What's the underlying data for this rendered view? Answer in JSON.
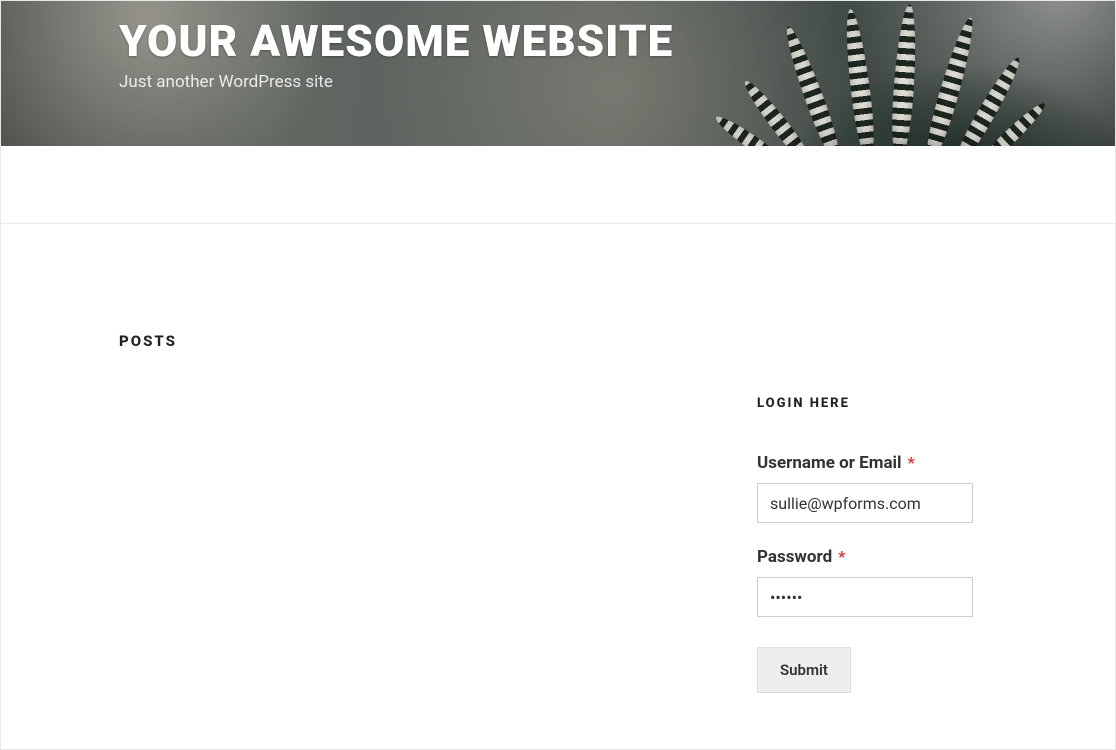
{
  "header": {
    "site_title": "YOUR AWESOME WEBSITE",
    "tagline": "Just another WordPress site"
  },
  "main": {
    "posts_heading": "POSTS"
  },
  "sidebar": {
    "widget_title": "LOGIN HERE",
    "form": {
      "username": {
        "label": "Username or Email",
        "required_marker": "*",
        "value": "sullie@wpforms.com"
      },
      "password": {
        "label": "Password",
        "required_marker": "*",
        "value": "••••••"
      },
      "submit_label": "Submit"
    }
  }
}
